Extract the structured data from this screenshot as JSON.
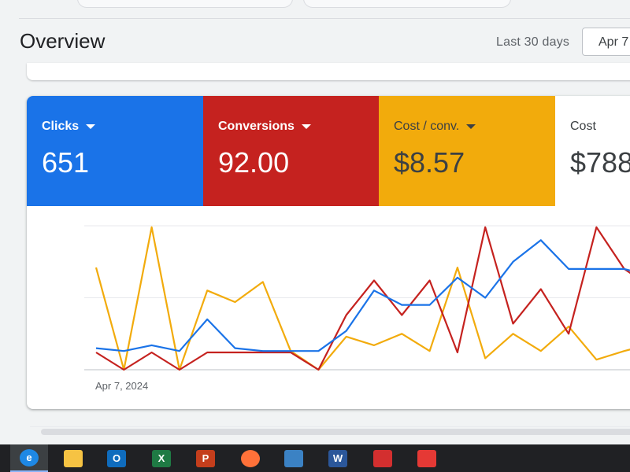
{
  "header": {
    "title": "Overview",
    "range_label": "Last 30 days",
    "date_button": "Apr 7"
  },
  "metrics": [
    {
      "label": "Clicks",
      "value": "651",
      "color": "#1a73e8",
      "selected": true
    },
    {
      "label": "Conversions",
      "value": "92.00",
      "color": "#c5221f",
      "selected": true
    },
    {
      "label": "Cost / conv.",
      "value": "$8.57",
      "color": "#f2ab0c",
      "selected": true
    },
    {
      "label": "Cost",
      "value": "$788",
      "color": "#ffffff",
      "selected": false
    }
  ],
  "chart_data": {
    "type": "line",
    "x_start_label": "Apr 7, 2024",
    "ylim": [
      0,
      100
    ],
    "grid": true,
    "series": [
      {
        "name": "Clicks",
        "color": "#1a73e8",
        "values": [
          15,
          13,
          17,
          13,
          35,
          15,
          13,
          13,
          13,
          27,
          55,
          45,
          45,
          64,
          50,
          75,
          90,
          70,
          70,
          70,
          65
        ]
      },
      {
        "name": "Conversions",
        "color": "#c5221f",
        "values": [
          12,
          0,
          12,
          0,
          12,
          12,
          12,
          12,
          0,
          38,
          62,
          38,
          62,
          12,
          99,
          32,
          56,
          25,
          99,
          70,
          57
        ]
      },
      {
        "name": "Cost / conv.",
        "color": "#f2ab0c",
        "values": [
          71,
          0,
          99,
          0,
          55,
          47,
          61,
          13,
          0,
          23,
          17,
          25,
          13,
          71,
          8,
          25,
          13,
          30,
          7,
          13,
          18
        ]
      }
    ]
  },
  "taskbar": {
    "apps": [
      {
        "name": "edge-icon",
        "letter": "e",
        "color": "#1e88e5"
      },
      {
        "name": "file-explorer-icon",
        "letter": "",
        "color": "#f6c343"
      },
      {
        "name": "outlook-icon",
        "letter": "O",
        "color": "#0f6cbd"
      },
      {
        "name": "excel-icon",
        "letter": "X",
        "color": "#1f7a44"
      },
      {
        "name": "powerpoint-icon",
        "letter": "P",
        "color": "#c43e1c"
      },
      {
        "name": "firefox-icon",
        "letter": "",
        "color": "#ff7139"
      },
      {
        "name": "window-app-icon",
        "letter": "",
        "color": "#3b82c4"
      },
      {
        "name": "word-icon",
        "letter": "W",
        "color": "#2b579a"
      },
      {
        "name": "sync-app-icon",
        "letter": "",
        "color": "#d32f2f"
      },
      {
        "name": "pdf-icon",
        "letter": "",
        "color": "#e53935"
      }
    ]
  }
}
